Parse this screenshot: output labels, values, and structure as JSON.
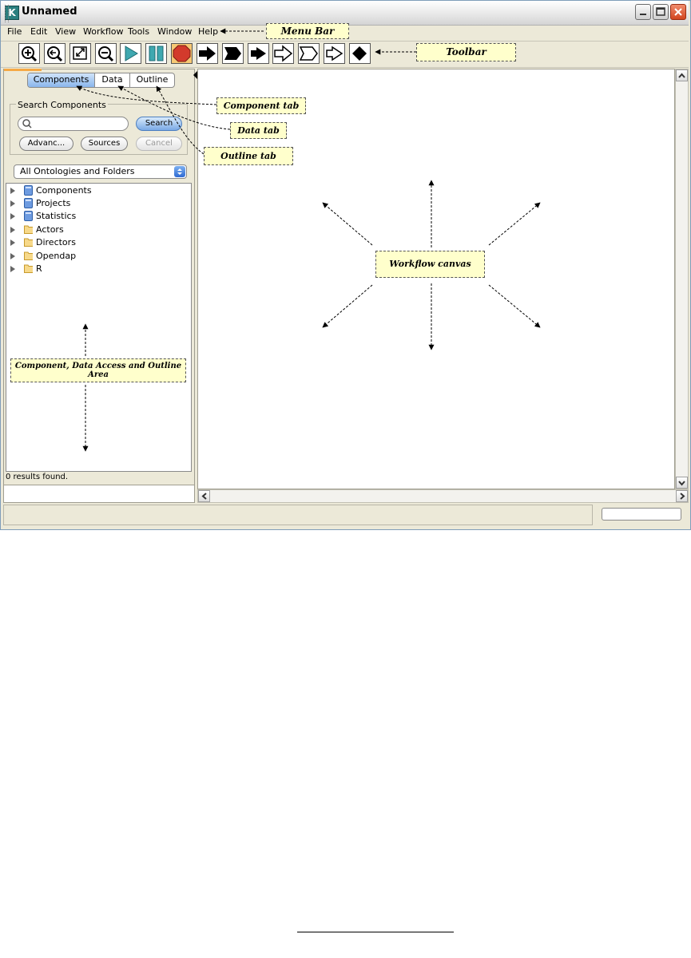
{
  "window": {
    "title": "Unnamed",
    "app_icon_letter": "K"
  },
  "menu": [
    {
      "label": "File"
    },
    {
      "label": "Edit"
    },
    {
      "label": "View"
    },
    {
      "label": "Workflow"
    },
    {
      "label": "Tools"
    },
    {
      "label": "Window"
    },
    {
      "label": "Help"
    }
  ],
  "toolbar": {
    "buttons": [
      "zoom-in-icon",
      "zoom-reset-icon",
      "zoom-fit-icon",
      "zoom-out-icon",
      "run-icon",
      "pause-icon",
      "stop-icon",
      "arrow-icon",
      "flag-arrow-icon",
      "short-arrow-icon",
      "hollow-arrow-icon",
      "hollow-flag-arrow-icon",
      "hollow-short-arrow-icon",
      "diamond-icon"
    ]
  },
  "left_panel": {
    "tabs": [
      {
        "label": "Components"
      },
      {
        "label": "Data"
      },
      {
        "label": "Outline"
      }
    ],
    "search_group_label": "Search Components",
    "search_input_value": "",
    "search_button": "Search",
    "advanced_button": "Advanc...",
    "sources_button": "Sources",
    "cancel_button": "Cancel",
    "ontology_dropdown": "All Ontologies and Folders",
    "tree": [
      {
        "label": "Components",
        "icon": "ontology-icon"
      },
      {
        "label": "Projects",
        "icon": "ontology-icon"
      },
      {
        "label": "Statistics",
        "icon": "ontology-icon"
      },
      {
        "label": "Actors",
        "icon": "folder-icon"
      },
      {
        "label": "Directors",
        "icon": "folder-icon"
      },
      {
        "label": "Opendap",
        "icon": "folder-icon"
      },
      {
        "label": "R",
        "icon": "folder-icon"
      }
    ],
    "results_text": "0 results found."
  },
  "callouts": {
    "menu_bar": "Menu Bar",
    "toolbar": "Toolbar",
    "component_tab": "Component tab",
    "data_tab": "Data tab",
    "outline_tab": "Outline tab",
    "workflow_canvas": "Workflow canvas",
    "component_area_line1": "Component, Data Access and Outline",
    "component_area_line2": "Area"
  },
  "colors": {
    "callout_fill": "#ffffcc",
    "tab_selected": "#8ab6ec",
    "stop_button": "#f6c874",
    "stop_octagon": "#d33a2c",
    "run_button": "#3fa8b0"
  }
}
